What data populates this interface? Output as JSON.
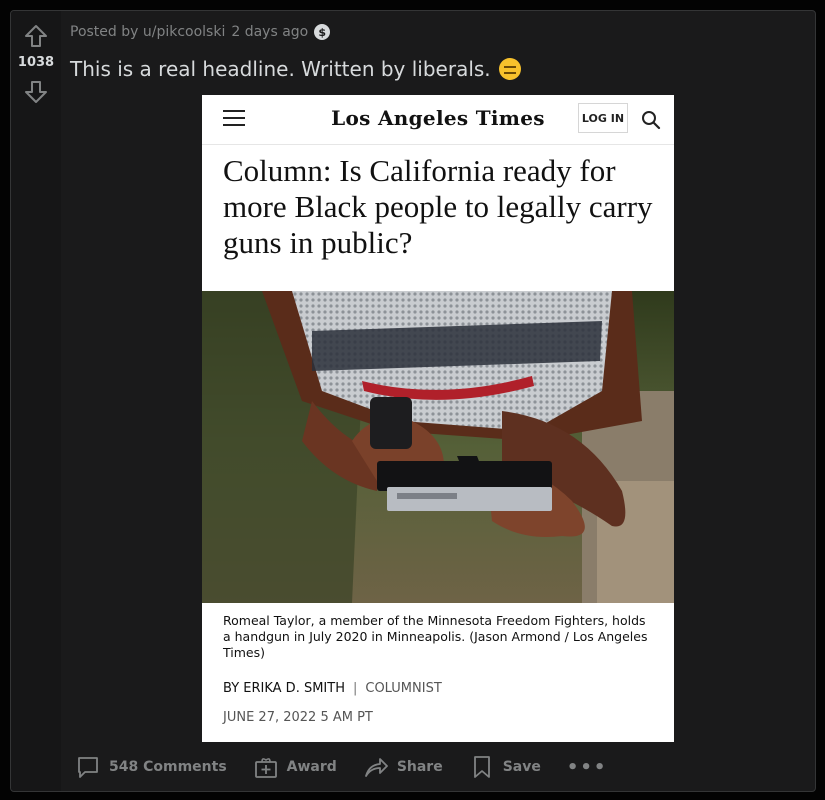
{
  "vote": {
    "score": "1038",
    "up_icon": "arrow-up-icon",
    "down_icon": "arrow-down-icon"
  },
  "post": {
    "posted_by": "Posted by u/pikcoolski",
    "age": "2 days ago",
    "award_badge": "$",
    "title": "This is a real headline. Written by liberals.",
    "emoji": "expressionless-face-emoji"
  },
  "article": {
    "masthead": "Los Angeles Times",
    "login_label": "LOG IN",
    "headline": "Column: Is California ready for more Black people to legally carry guns in public?",
    "caption": "Romeal Taylor, a member of the Minnesota Freedom Fighters, holds a handgun in July 2020 in Minneapolis. (Jason Armond / Los Angeles Times)",
    "byline": "BY ERIKA D. SMITH",
    "byline_sep": "|",
    "role": "COLUMNIST",
    "date": "JUNE 27, 2022 5 AM PT"
  },
  "actions": {
    "comments": "548 Comments",
    "award": "Award",
    "share": "Share",
    "save": "Save",
    "more": "•••"
  },
  "colors": {
    "page_bg": "#030303",
    "card_bg": "#1a1a1b",
    "muted": "#818384",
    "text": "#d7dadc"
  }
}
